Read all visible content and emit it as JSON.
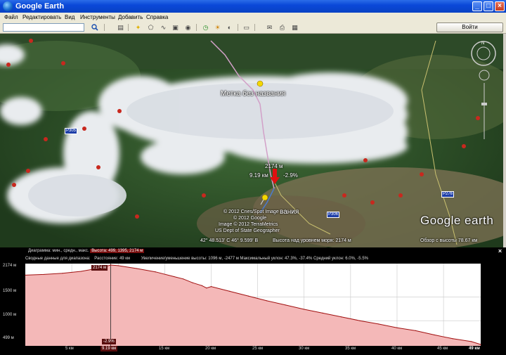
{
  "window": {
    "title": "Google Earth"
  },
  "menu": [
    "Файл",
    "Редактировать",
    "Вид",
    "Инструменты",
    "Добавить",
    "Справка"
  ],
  "toolbar": {
    "login_label": "Войти",
    "search_placeholder": ""
  },
  "map": {
    "placemark_title": "Метка без названия",
    "second_placemark_title": "вания",
    "distance_label": "2174 м",
    "km_label": "9.19 км",
    "slope_label": "-2.9%",
    "road_labels": [
      "P305",
      "P276",
      "P306"
    ],
    "credits": [
      "© 2012 Cnes/Spot Image",
      "© 2012 Google",
      "Image © 2012 TerraMetrics",
      "US Dept of State Geographer"
    ],
    "status_coords": "42° 48.513' С  46° 9.599' В",
    "status_elevation": "Высота над уровнем моря:  2174 м",
    "status_view": "Обзор с высоты    78.67 км",
    "logo": "Google earth"
  },
  "profile": {
    "header_prefix": "Диаграмма: мин., средн., макс.",
    "header_highlight": "Высота: 499, 1395, 2174 м",
    "summary_prefix": "Сводные данные для диапазона:",
    "distance": "Расстояние: 49 км",
    "summary_rest": "Увеличение/уменьшение высоты: 1096 м, -2477 м   Максимальный уклон: 47.3%, -37.4%   Средний уклон: 6.0%, -5.5%",
    "cursor_elevation": "2174 м",
    "cursor_slope": "-2.9%",
    "cursor_distance": "9.19 км",
    "end_label": "49 км",
    "y_ticks": [
      "2174 м",
      "1500 м",
      "1000 м",
      "499 м"
    ],
    "x_ticks": [
      "5 км",
      "15 км",
      "20 км",
      "25 км",
      "30 км",
      "35 км",
      "40 км",
      "45 км"
    ]
  },
  "chart_data": {
    "type": "area",
    "x": [
      0,
      2,
      4,
      6,
      8,
      9.19,
      10,
      12,
      14,
      16,
      17,
      18,
      19,
      19.5,
      20,
      22,
      24,
      26,
      28,
      30,
      32,
      34,
      36,
      38,
      40,
      42,
      44,
      46,
      48,
      49
    ],
    "y": [
      1960,
      1975,
      2000,
      2040,
      2110,
      2174,
      2160,
      2100,
      2030,
      1930,
      1880,
      1800,
      1740,
      1690,
      1720,
      1620,
      1520,
      1420,
      1330,
      1240,
      1160,
      1080,
      1000,
      930,
      850,
      790,
      700,
      620,
      560,
      499
    ],
    "xlabel": "",
    "ylabel": "",
    "xlim": [
      0,
      49
    ],
    "ylim": [
      499,
      2174
    ],
    "grid": true,
    "colors": {
      "fill": "#f4b8b8",
      "line": "#a01010"
    }
  }
}
